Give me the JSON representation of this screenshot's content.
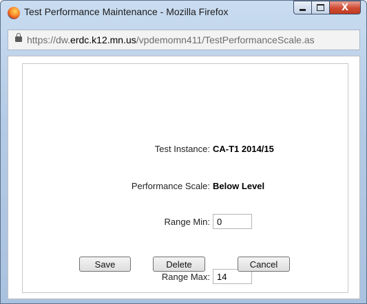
{
  "window": {
    "title": "Test Performance Maintenance - Mozilla Firefox",
    "controls": {
      "minimize_icon": "minimize-icon",
      "maximize_icon": "maximize-icon",
      "close_label": "X"
    }
  },
  "urlbar": {
    "scheme": "https://dw.",
    "domain": "erdc.k12.mn.us",
    "path": "/vpdemomn411/TestPerformanceScale.as"
  },
  "form": {
    "test_instance_label": "Test Instance:",
    "test_instance_value": "CA-T1 2014/15",
    "performance_scale_label": "Performance Scale:",
    "performance_scale_value": "Below Level",
    "range_min_label": "Range Min:",
    "range_min_value": "0",
    "range_max_label": "Range Max:",
    "range_max_value": "14"
  },
  "buttons": {
    "save": "Save",
    "delete": "Delete",
    "cancel": "Cancel"
  }
}
